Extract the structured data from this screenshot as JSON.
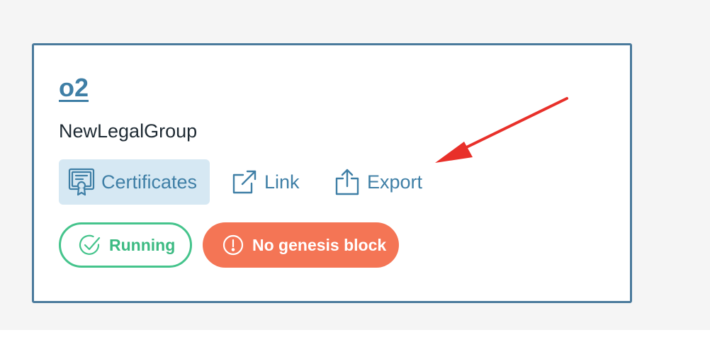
{
  "card": {
    "title": "o2",
    "subtitle": "NewLegalGroup",
    "actions": [
      {
        "label": "Certificates",
        "icon": "certificate-icon",
        "selected": true
      },
      {
        "label": "Link",
        "icon": "external-link-icon"
      },
      {
        "label": "Export",
        "icon": "export-icon"
      }
    ],
    "badges": [
      {
        "label": "Running",
        "icon": "check-circle-icon",
        "color": "#45c48c"
      },
      {
        "label": "No genesis block",
        "icon": "alert-circle-icon",
        "color": "#f47555"
      }
    ]
  },
  "annotation": {
    "icon": "red-arrow-icon",
    "color": "#e8302a"
  },
  "colors": {
    "accent": "#3f7fa6",
    "border": "#4a7a9c",
    "selected_bg": "#d6e8f3",
    "background": "#f5f5f5"
  }
}
